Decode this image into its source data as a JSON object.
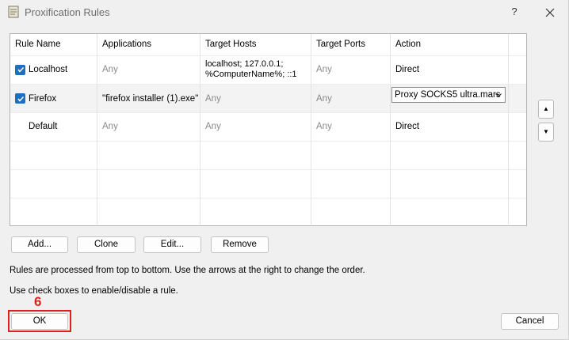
{
  "window": {
    "title": "Proxification Rules",
    "help_label": "?"
  },
  "table": {
    "columns": [
      "Rule Name",
      "Applications",
      "Target Hosts",
      "Target Ports",
      "Action"
    ],
    "rows": [
      {
        "checked": true,
        "name": "Localhost",
        "applications": "Any",
        "target_hosts_line1": "localhost; 127.0.0.1;",
        "target_hosts_line2": "%ComputerName%; ::1",
        "target_ports": "Any",
        "action": "Direct"
      },
      {
        "checked": true,
        "name": "Firefox",
        "applications": "\"firefox installer (1).exe\"",
        "target_hosts": "Any",
        "target_ports": "Any",
        "action": "Proxy SOCKS5 ultra.mars"
      },
      {
        "checked": false,
        "name": "Default",
        "applications": "Any",
        "target_hosts": "Any",
        "target_ports": "Any",
        "action": "Direct"
      }
    ]
  },
  "buttons": {
    "add": "Add...",
    "clone": "Clone",
    "edit": "Edit...",
    "remove": "Remove",
    "ok": "OK",
    "cancel": "Cancel",
    "move_up": "▲",
    "move_down": "▼"
  },
  "info": {
    "line1": "Rules are processed from top to bottom. Use the arrows at the right to change the order.",
    "line2": "Use check boxes to enable/disable a rule."
  },
  "annotation": {
    "step": "6"
  },
  "colors": {
    "checkbox": "#1f6fbf",
    "annotation": "#e02020",
    "selected_row": "#f3f3f3"
  }
}
